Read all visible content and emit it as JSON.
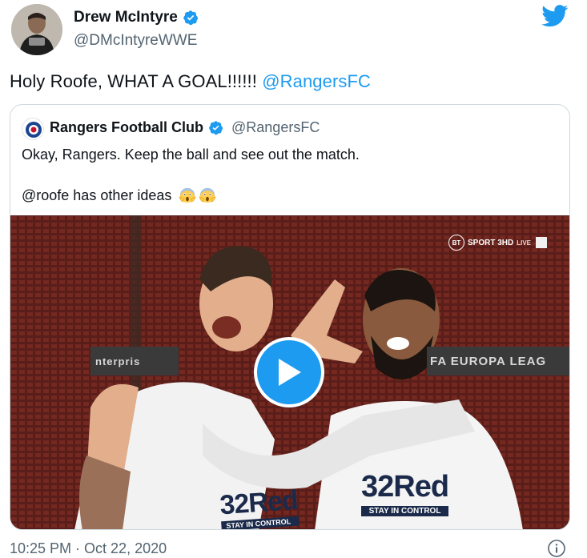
{
  "author": {
    "display_name": "Drew McIntyre",
    "handle": "@DMcIntyreWWE",
    "verified": true
  },
  "tweet": {
    "text_before": "Holy Roofe, WHAT A GOAL!!!!!! ",
    "mention": "@RangersFC"
  },
  "quoted": {
    "display_name": "Rangers Football Club",
    "handle": "@RangersFC",
    "verified": true,
    "line1": "Okay, Rangers. Keep the ball and see out the match.",
    "line2": "@roofe has other ideas",
    "emoji": [
      "face-screaming-in-fear",
      "face-screaming-in-fear"
    ],
    "video": {
      "broadcaster_badge": "BT",
      "broadcaster": "SPORT 3HD",
      "broadcaster_live": "LIVE",
      "board_left": "nterpris",
      "board_right": "FA EUROPA LEAG",
      "shirt_sponsor": "32Red",
      "shirt_slogan": "STAY IN CONTROL"
    }
  },
  "footer": {
    "timestamp": "10:25 PM · Oct 22, 2020"
  },
  "colors": {
    "accent": "#1d9bf0",
    "text": "#0f1419",
    "secondary": "#536471",
    "border": "#cfd9de"
  }
}
